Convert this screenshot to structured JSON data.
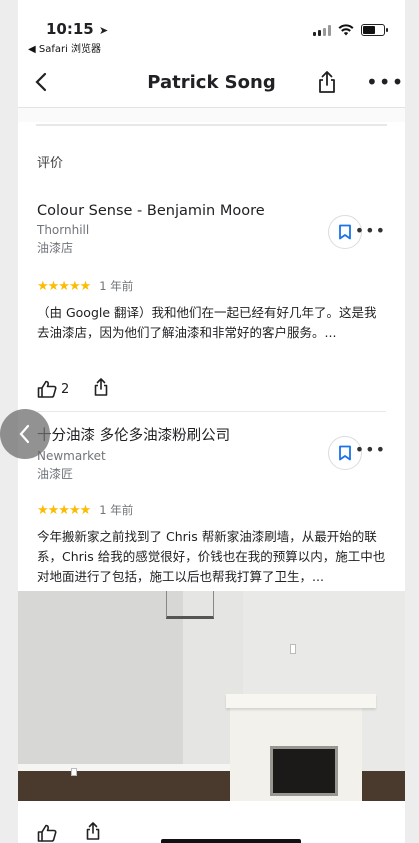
{
  "status_bar": {
    "time": "10:15",
    "back_app_label": "◀ Safari 浏览器"
  },
  "header": {
    "title": "Patrick Song"
  },
  "section": {
    "title": "评价"
  },
  "reviews": [
    {
      "place": "Colour Sense - Benjamin Moore",
      "location": "Thornhill",
      "category": "油漆店",
      "stars": "★★★★★",
      "age": "1 年前",
      "text": "（由 Google 翻译）我和他们在一起已经有好几年了。这是我去油漆店，因为他们了解油漆和非常好的客户服务。...",
      "likes": "2"
    },
    {
      "place": "十分油漆 多伦多油漆粉刷公司",
      "location": "Newmarket",
      "category": "油漆匠",
      "stars": "★★★★★",
      "age": "1 年前",
      "text": "今年搬新家之前找到了 Chris 帮新家油漆刷墙，从最开始的联系，Chris 给我的感觉很好，价钱也在我的预算以内，施工中也对地面进行了包括，施工以后也帮我打算了卫生，...",
      "likes": ""
    }
  ],
  "icons": {
    "back": "chevron-left-icon",
    "share": "share-icon",
    "more": "more-horizontal-icon",
    "save": "bookmark-icon",
    "like": "thumbs-up-icon"
  },
  "colors": {
    "star": "#fbbc04",
    "save_icon": "#1a73e8"
  }
}
